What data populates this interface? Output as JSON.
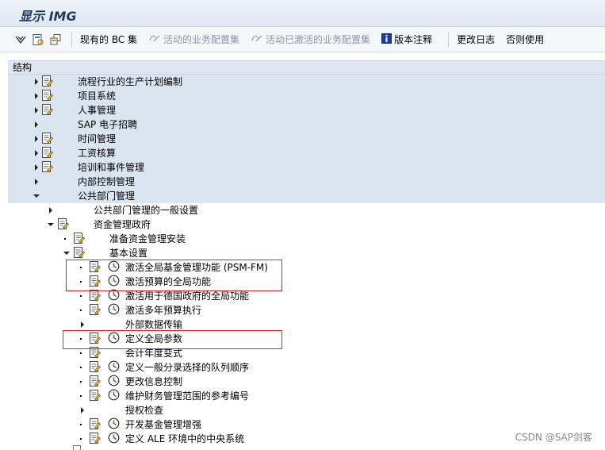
{
  "window": {
    "title": "显示 IMG"
  },
  "toolbar": {
    "existing_bc_sets": "现有的 BC 集",
    "activate_bc_sets": "活动的业务配置集",
    "activate_active_bc_sets": "活动已激活的业务配置集",
    "release_notes": "版本注释",
    "change_log": "更改日志",
    "if_not_use": "否则使用"
  },
  "tree": {
    "header": "结构",
    "items": [
      {
        "label": "流程行业的生产计划编制",
        "expander": "collapsed",
        "doc": true,
        "exec": false,
        "selected": true
      },
      {
        "label": "项目系统",
        "expander": "collapsed",
        "doc": true,
        "exec": false,
        "selected": true
      },
      {
        "label": "人事管理",
        "expander": "collapsed",
        "doc": true,
        "exec": false,
        "selected": true
      },
      {
        "label": "SAP 电子招聘",
        "expander": "collapsed",
        "doc": false,
        "exec": false,
        "selected": true
      },
      {
        "label": "时间管理",
        "expander": "collapsed",
        "doc": true,
        "exec": false,
        "selected": true
      },
      {
        "label": "工资核算",
        "expander": "collapsed",
        "doc": true,
        "exec": false,
        "selected": true
      },
      {
        "label": "培训和事件管理",
        "expander": "collapsed",
        "doc": true,
        "exec": false,
        "selected": true
      },
      {
        "label": "内部控制管理",
        "expander": "collapsed",
        "doc": false,
        "exec": false,
        "selected": true
      },
      {
        "label": "公共部门管理",
        "expander": "expanded",
        "doc": false,
        "exec": false,
        "selected": true
      },
      {
        "label": "公共部门管理的一般设置",
        "expander": "collapsed",
        "doc": false,
        "exec": false,
        "selected": false
      },
      {
        "label": "资金管理政府",
        "expander": "expanded",
        "doc": true,
        "exec": false,
        "selected": false
      },
      {
        "label": "准备资金管理安装",
        "expander": "dot",
        "doc": true,
        "exec": false,
        "selected": false
      },
      {
        "label": "基本设置",
        "expander": "expanded",
        "doc": true,
        "exec": false,
        "selected": false
      },
      {
        "label": "激活全局基金管理功能 (PSM-FM)",
        "expander": "dot",
        "doc": true,
        "exec": true,
        "selected": false
      },
      {
        "label": "激活预算的全局功能",
        "expander": "dot",
        "doc": true,
        "exec": true,
        "selected": false
      },
      {
        "label": "激活用于德国政府的全局功能",
        "expander": "dot",
        "doc": true,
        "exec": true,
        "selected": false
      },
      {
        "label": "激活多年预算执行",
        "expander": "dot",
        "doc": true,
        "exec": true,
        "selected": false
      },
      {
        "label": "外部数据传输",
        "expander": "collapsed",
        "doc": false,
        "exec": false,
        "selected": false
      },
      {
        "label": "定义全局参数",
        "expander": "dot",
        "doc": true,
        "exec": true,
        "selected": false
      },
      {
        "label": "会计年度变式",
        "expander": "dot",
        "doc": true,
        "exec": false,
        "selected": false
      },
      {
        "label": "定义一般分录选择的队列顺序",
        "expander": "dot",
        "doc": true,
        "exec": true,
        "selected": false
      },
      {
        "label": "更改信息控制",
        "expander": "dot",
        "doc": true,
        "exec": true,
        "selected": false
      },
      {
        "label": "维护财务管理范围的参考编号",
        "expander": "dot",
        "doc": true,
        "exec": true,
        "selected": false
      },
      {
        "label": "授权检查",
        "expander": "collapsed",
        "doc": false,
        "exec": false,
        "selected": false
      },
      {
        "label": "开发基金管理增强",
        "expander": "dot",
        "doc": true,
        "exec": true,
        "selected": false
      },
      {
        "label": "定义 ALE 环境中的中央系统",
        "expander": "dot",
        "doc": true,
        "exec": true,
        "selected": false
      }
    ]
  },
  "watermark": "CSDN @SAP剑客",
  "colors": {
    "highlight_box": "#d9232e",
    "selected_row": "#dbe5ef",
    "title_text": "#1d3a5c"
  }
}
